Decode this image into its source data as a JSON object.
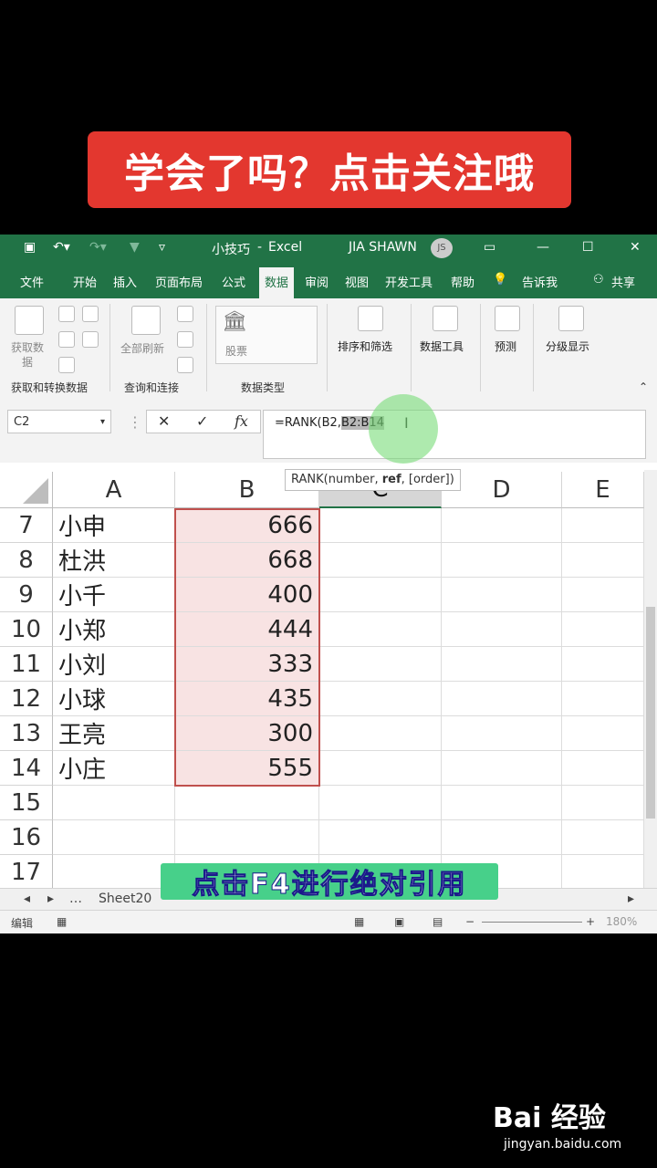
{
  "banner": "学会了吗？点击关注哦",
  "excel": {
    "title": {
      "doc": "小技巧",
      "sep": "-",
      "app": "Excel",
      "user": "JIA SHAWN",
      "avatar": "JS"
    },
    "tabs": [
      "文件",
      "开始",
      "插入",
      "页面布局",
      "公式",
      "数据",
      "审阅",
      "视图",
      "开发工具",
      "帮助",
      "告诉我",
      "共享"
    ],
    "active_tab": "数据",
    "ribbon": {
      "get_data": "获取数\n据",
      "refresh_all": "全部刷新",
      "stocks": "股票",
      "sort_filter": "排序和筛选",
      "data_tools": "数据工具",
      "forecast": "预测",
      "outline": "分级显示",
      "groups": [
        "获取和转换数据",
        "查询和连接",
        "数据类型"
      ]
    },
    "name_box": "C2",
    "formula_prefix": "=RANK(B2,",
    "formula_selected": "B2:B14",
    "tooltip": {
      "pre": "RANK(number, ",
      "bold": "ref",
      "post": ", [order])"
    },
    "columns": [
      "A",
      "B",
      "C",
      "D",
      "E"
    ],
    "rows": [
      {
        "n": "7",
        "a": "小申",
        "b": "666"
      },
      {
        "n": "8",
        "a": "杜洪",
        "b": "668"
      },
      {
        "n": "9",
        "a": "小千",
        "b": "400"
      },
      {
        "n": "10",
        "a": "小郑",
        "b": "444"
      },
      {
        "n": "11",
        "a": "小刘",
        "b": "333"
      },
      {
        "n": "12",
        "a": "小球",
        "b": "435"
      },
      {
        "n": "13",
        "a": "王亮",
        "b": "300"
      },
      {
        "n": "14",
        "a": "小庄",
        "b": "555"
      },
      {
        "n": "15",
        "a": "",
        "b": ""
      },
      {
        "n": "16",
        "a": "",
        "b": ""
      },
      {
        "n": "17",
        "a": "",
        "b": ""
      }
    ],
    "sheet_tab": "Sheet20",
    "status": "编辑",
    "zoom": "180%"
  },
  "caption": "点击F4进行绝对引用",
  "watermark": {
    "brand": "Bai 经验",
    "url": "jingyan.baidu.com"
  },
  "colors": {
    "excel_green": "#217346",
    "banner_red": "#e3372f",
    "caption_green": "#47d08a",
    "range_border": "#c0504d"
  }
}
